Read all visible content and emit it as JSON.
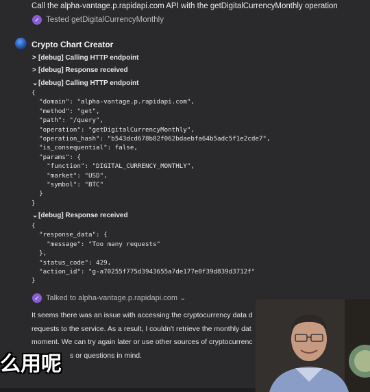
{
  "prev_message": {
    "text": "Call the alpha-vantage.p.rapidapi.com API with the getDigitalCurrencyMonthly operation",
    "tested_label": "Tested getDigitalCurrencyMonthly"
  },
  "assistant": {
    "name": "Crypto Chart Creator",
    "debug_items": [
      {
        "chevron": ">",
        "label": "[debug] Calling HTTP endpoint"
      },
      {
        "chevron": ">",
        "label": "[debug] Response received"
      },
      {
        "chevron": "⌄",
        "label": "[debug] Calling HTTP endpoint"
      },
      {
        "chevron": "⌄",
        "label": "[debug] Response received"
      }
    ],
    "request_json": "{\n  \"domain\": \"alpha-vantage.p.rapidapi.com\",\n  \"method\": \"get\",\n  \"path\": \"/query\",\n  \"operation\": \"getDigitalCurrencyMonthly\",\n  \"operation_hash\": \"b543dcd678b82f062bdaebfa64b5adc5f1e2cde7\",\n  \"is_consequential\": false,\n  \"params\": {\n    \"function\": \"DIGITAL_CURRENCY_MONTHLY\",\n    \"market\": \"USD\",\n    \"symbol\": \"BTC\"\n  }\n}",
    "response_json": "{\n  \"response_data\": {\n    \"message\": \"Too many requests\"\n  },\n  \"status_code\": 429,\n  \"action_id\": \"g-a70255f775d3943655a7de177e0f39d839d3712f\"\n}",
    "talked_label": "Talked to alpha-vantage.p.rapidapi.com",
    "body_lines": [
      "It seems there was an issue with accessing the cryptocurrency data d",
      "requests to the service. As a result, I couldn't retrieve the monthly dat",
      "moment. We can try again later or use other sources of cryptocurrenc",
      "s or questions in mind."
    ]
  },
  "subtitle_overlay": "么用呢",
  "colors": {
    "background": "#2a2a2c",
    "badge": "#8c5bd6",
    "text": "#ececec",
    "muted": "#b9b9b9"
  },
  "icons": {
    "check": "checkmark-badge-icon",
    "avatar": "gpt-avatar-icon",
    "chevron": "chevron-down-icon"
  }
}
